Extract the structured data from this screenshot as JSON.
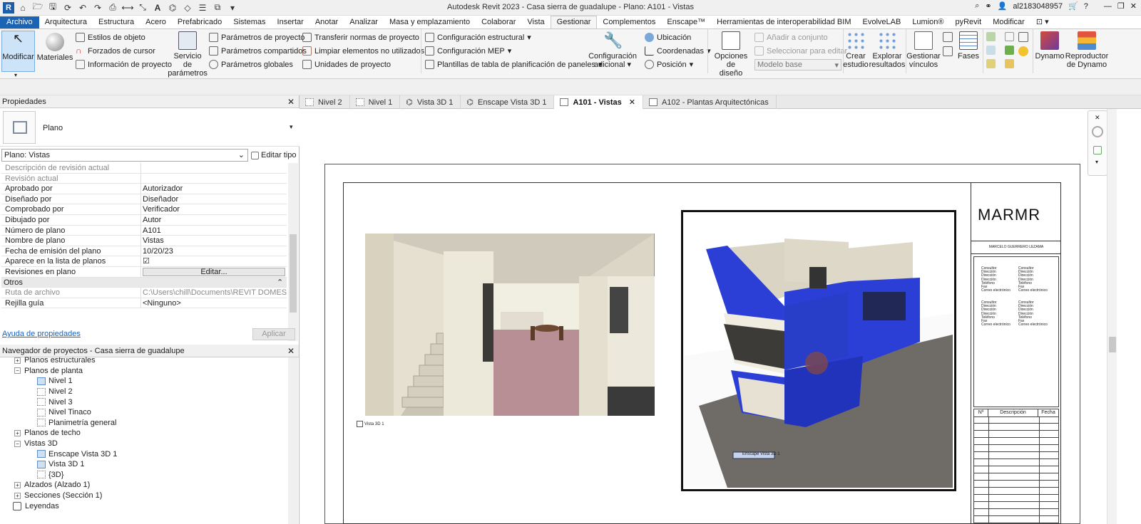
{
  "window": {
    "title": "Autodesk Revit 2023 - Casa sierra de guadalupe - Plano: A101 - Vistas",
    "user": "al2183048957",
    "logo_letter": "R"
  },
  "menu_tabs": [
    "Archivo",
    "Arquitectura",
    "Estructura",
    "Acero",
    "Prefabricado",
    "Sistemas",
    "Insertar",
    "Anotar",
    "Analizar",
    "Masa y emplazamiento",
    "Colaborar",
    "Vista",
    "Gestionar",
    "Complementos",
    "Enscape™",
    "Herramientas de interoperabilidad BIM",
    "EvolveLAB",
    "Lumion®",
    "pyRevit",
    "Modificar"
  ],
  "ribbon": {
    "modify": "Modificar",
    "materials": "Materiales",
    "obj_styles": "Estilos de objeto",
    "snaps": "Forzados de cursor",
    "project_info": "Información de proyecto",
    "param_service_1": "Servicio de",
    "param_service_2": "parámetros",
    "project_params": "Parámetros de proyecto",
    "shared_params": "Parámetros compartidos",
    "global_params": "Parámetros  globales",
    "transfer": "Transferir normas de proyecto",
    "purge": "Limpiar elementos no utilizados",
    "units": "Unidades de proyecto",
    "struct_cfg": "Configuración  estructural",
    "mep_cfg": "Configuración MEP",
    "panel_templates": "Plantillas de tabla de planificación de paneles",
    "addl_cfg_1": "Configuración",
    "addl_cfg_2": "adicional",
    "location": "Ubicación",
    "coordinates": "Coordenadas",
    "position": "Posición",
    "design_opts_1": "Opciones de",
    "design_opts_2": "diseño",
    "add_to_set": "Añadir a conjunto",
    "pick_to_edit": "Seleccionar para editar",
    "main_model": "Modelo base",
    "create_study_1": "Crear",
    "create_study_2": "estudio",
    "explore_results_1": "Explorar",
    "explore_results_2": "resultados",
    "manage_links_1": "Gestionar",
    "manage_links_2": "vínculos",
    "phases": "Fases",
    "dynamo": "Dynamo",
    "dynamo_player_1": "Reproductor",
    "dynamo_player_2": "de Dynamo"
  },
  "properties": {
    "title": "Propiedades",
    "type_name": "Plano",
    "instance_select": "Plano: Vistas",
    "edit_type": "Editar tipo",
    "rows": [
      {
        "label": "Descripción de revisión actual",
        "value": ""
      },
      {
        "label": "Revisión actual",
        "value": ""
      },
      {
        "label": "Aprobado por",
        "value": "Autorizador"
      },
      {
        "label": "Diseñado por",
        "value": "Diseñador"
      },
      {
        "label": "Comprobado por",
        "value": "Verificador"
      },
      {
        "label": "Dibujado por",
        "value": "Autor"
      },
      {
        "label": "Número de plano",
        "value": "A101"
      },
      {
        "label": "Nombre de plano",
        "value": "Vistas"
      },
      {
        "label": "Fecha de emisión del plano",
        "value": "10/20/23"
      },
      {
        "label": "Aparece en la lista de planos",
        "value": "☑"
      },
      {
        "label": "Revisiones en plano",
        "value": "Editar..."
      }
    ],
    "section_other": "Otros",
    "rows2": [
      {
        "label": "Ruta de archivo",
        "value": "C:\\Users\\chill\\Documents\\REVIT DOMESTI..."
      },
      {
        "label": "Rejilla guía",
        "value": "<Ninguno>"
      }
    ],
    "help_link": "Ayuda de propiedades",
    "apply": "Aplicar"
  },
  "browser": {
    "title": "Navegador de proyectos - Casa sierra de guadalupe",
    "structural_plans": "Planos estructurales",
    "floor_plans": "Planos de planta",
    "fp_items": [
      "Nivel 1",
      "Nivel 2",
      "Nivel 3",
      "Nivel Tinaco",
      "Planimetría general"
    ],
    "ceiling_plans": "Planos de techo",
    "views_3d": "Vistas 3D",
    "v3d_items": [
      "Enscape Vista 3D 1",
      "Vista 3D 1",
      "{3D}"
    ],
    "elevations": "Alzados (Alzado 1)",
    "sections": "Secciones (Sección 1)",
    "legends": "Leyendas"
  },
  "view_tabs": [
    "Nivel 2",
    "Nivel 1",
    "Vista 3D 1",
    "Enscape Vista 3D 1",
    "A101 - Vistas",
    "A102 - Plantas Arquitectónicas"
  ],
  "sheet": {
    "logo": "MARMR",
    "designer": "MARCELO GUERRERO LEZAMA",
    "consultants": [
      "Consultor",
      "Dirección",
      "Dirección",
      "Dirección",
      "Teléfono",
      "Fax",
      "Correo electrónico"
    ],
    "rev_headers": [
      "Nº",
      "Descripción",
      "Fecha"
    ],
    "viewport1_label": "Vista 3D 1",
    "viewport2_label": "Enscape Vista 3D 1"
  },
  "colors": {
    "file_tab": "#1b63b5",
    "house_blue": "#2b3fd6",
    "floor_pink": "#b88f95"
  }
}
